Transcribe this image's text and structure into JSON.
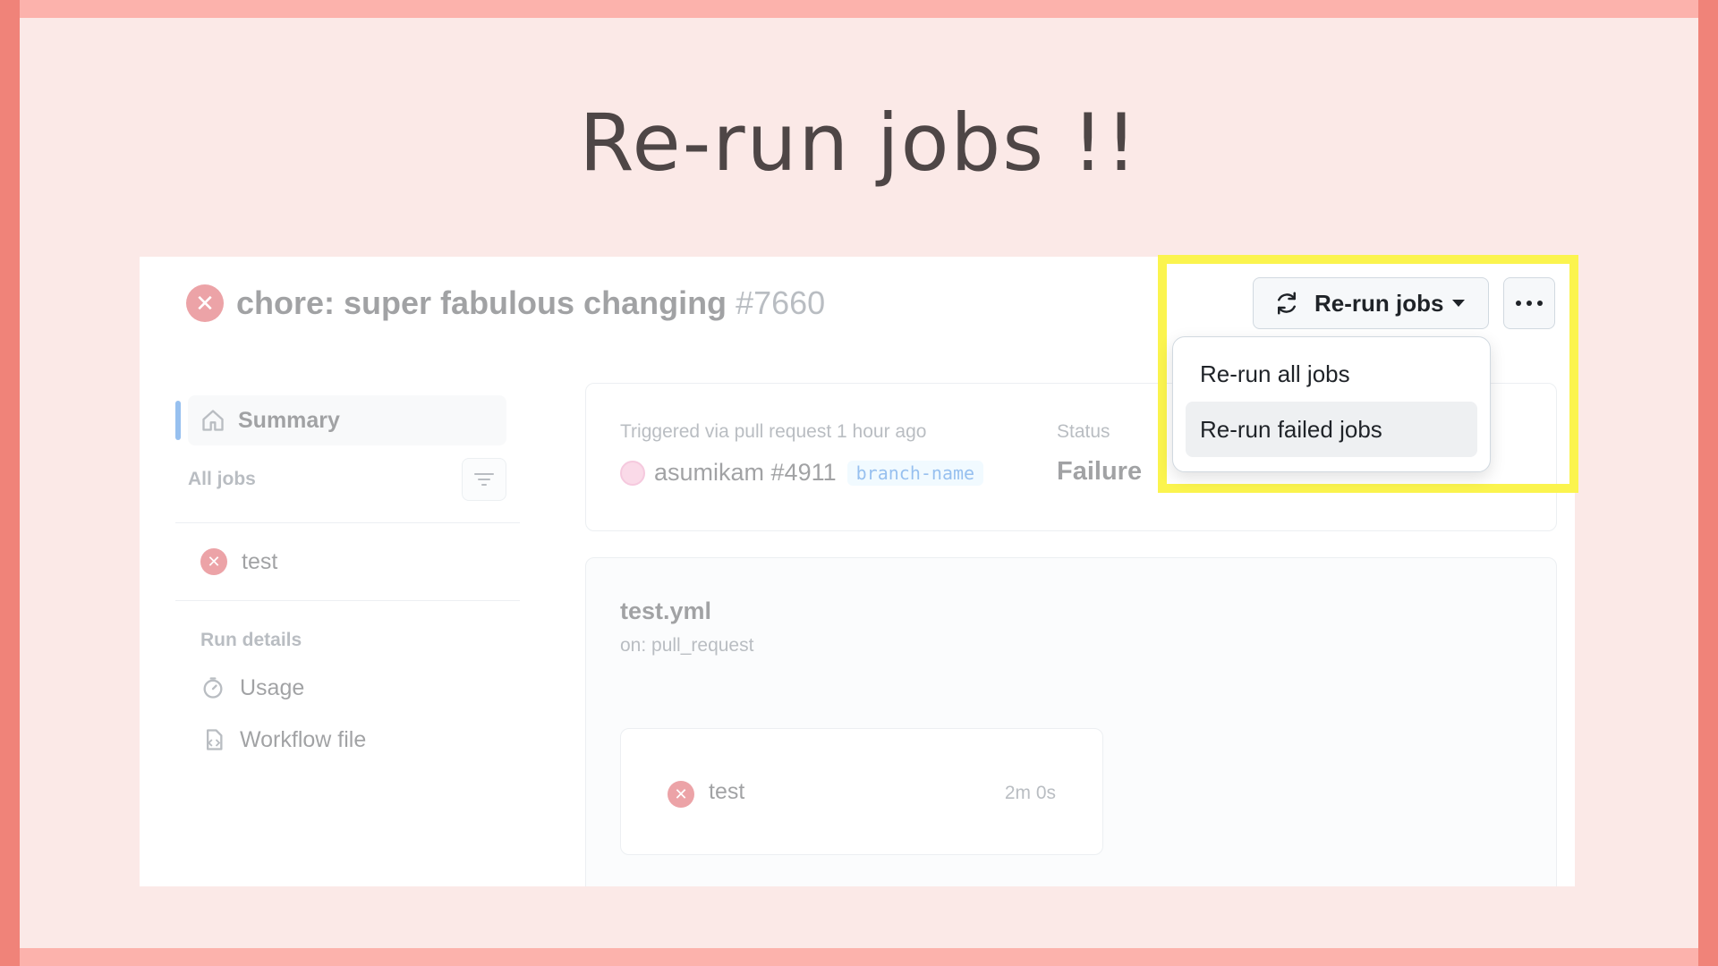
{
  "slide": {
    "title": "Re-run jobs !!"
  },
  "run": {
    "title": "chore: super fabulous changing",
    "number": "#7660"
  },
  "sidebar": {
    "summary_label": "Summary",
    "all_jobs_label": "All jobs",
    "jobs": [
      {
        "name": "test",
        "status": "failure"
      }
    ],
    "run_details_label": "Run details",
    "details": [
      {
        "label": "Usage"
      },
      {
        "label": "Workflow file"
      }
    ]
  },
  "trigger": {
    "text": "Triggered via pull request 1 hour ago",
    "actor": "asumikam #4911",
    "branch": "branch-name",
    "status_label": "Status",
    "status_value": "Failure"
  },
  "workflow": {
    "file": "test.yml",
    "on": "on: pull_request",
    "job": {
      "name": "test",
      "duration": "2m 0s"
    }
  },
  "toolbar": {
    "rerun_label": "Re-run jobs"
  },
  "rerun_menu": {
    "items": [
      {
        "label": "Re-run all jobs"
      },
      {
        "label": "Re-run failed jobs",
        "highlighted": true
      }
    ]
  },
  "colors": {
    "highlight": "#fbf44e",
    "failure": "#d1242f",
    "accent": "#0969da"
  }
}
